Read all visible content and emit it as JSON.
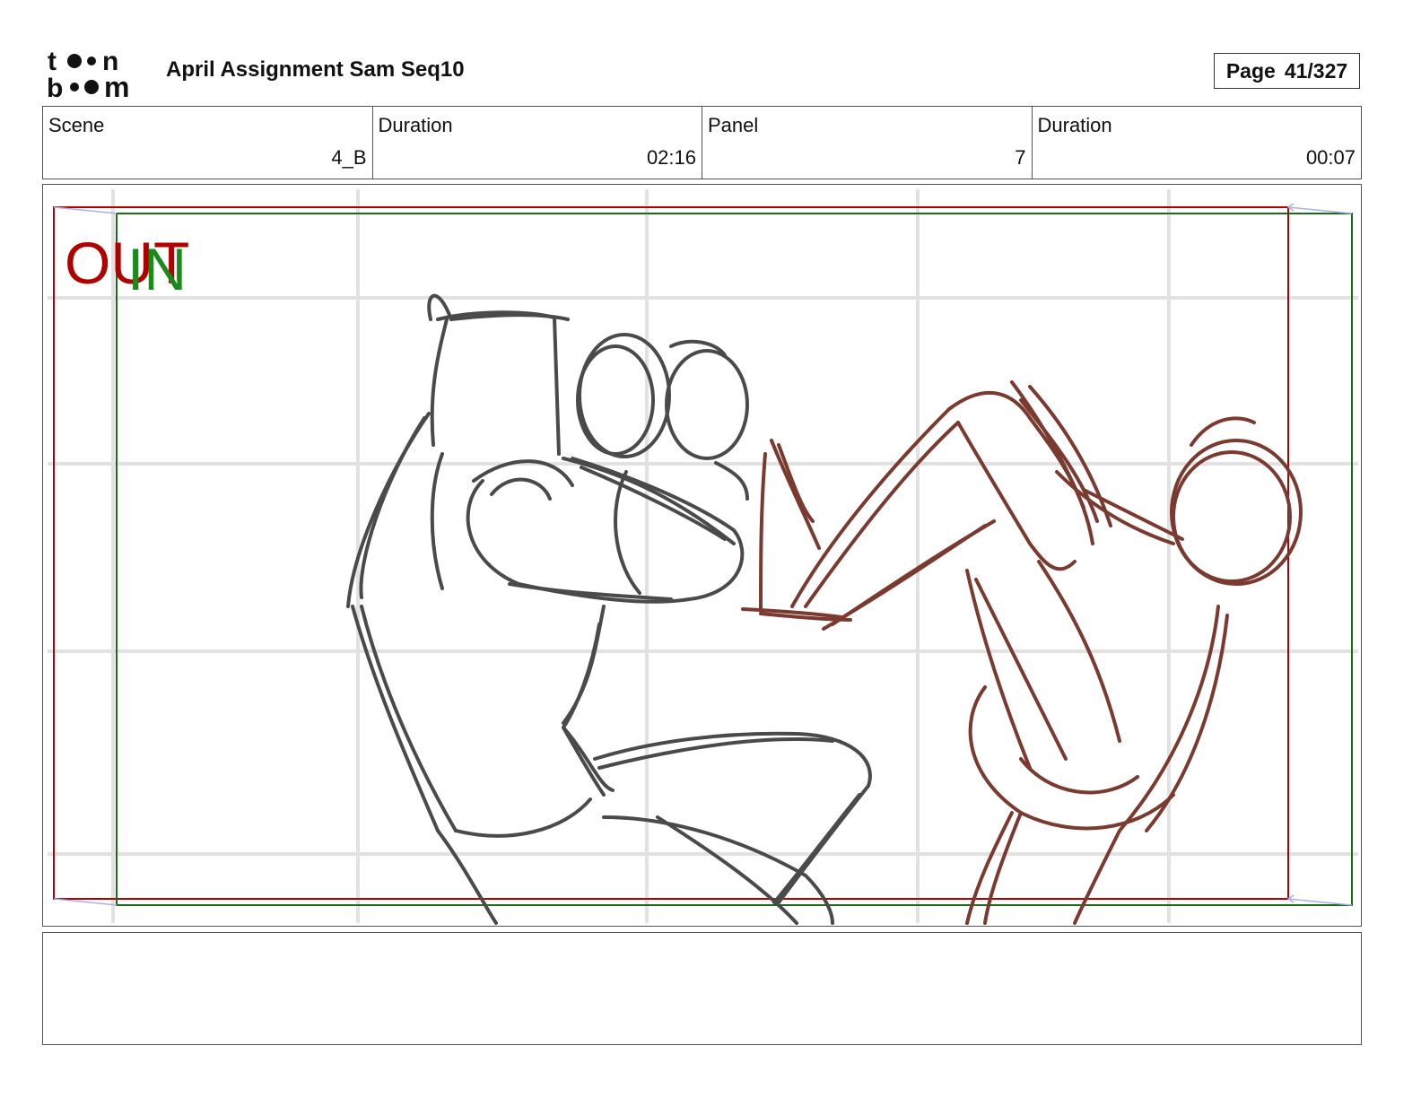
{
  "header": {
    "logo_text": "toonboom",
    "title": "April Assignment Sam Seq10",
    "page_label": "Page",
    "page_value": "41/327"
  },
  "info": {
    "scene_label": "Scene",
    "scene_value": "4_B",
    "scene_duration_label": "Duration",
    "scene_duration_value": "02:16",
    "panel_label": "Panel",
    "panel_value": "7",
    "panel_duration_label": "Duration",
    "panel_duration_value": "00:07"
  },
  "panel": {
    "out_label": "OUT",
    "in_label": "IN",
    "out_color": "#b00000",
    "in_color": "#1a8a1a",
    "sketch_dark_color": "#4a4a4a",
    "sketch_red_color": "#7a3a30"
  },
  "caption": {
    "text": ""
  }
}
